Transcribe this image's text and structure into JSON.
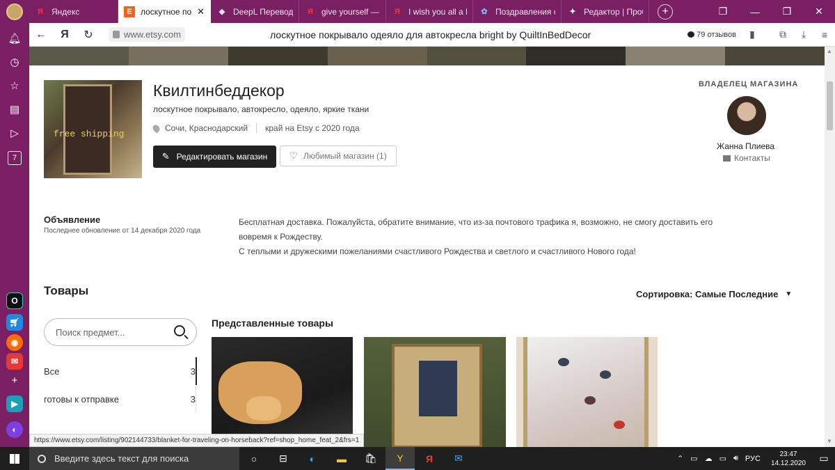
{
  "browser": {
    "tabs": [
      {
        "title": "Яндекс",
        "favicon": "Я",
        "fav_color": "#ff3333",
        "active": false
      },
      {
        "title": "лоскутное пок",
        "favicon": "E",
        "fav_color": "#f1641e",
        "active": true
      },
      {
        "title": "DeepL Переводч",
        "favicon": "◆",
        "fav_color": "#dfe6f0",
        "active": false
      },
      {
        "title": "give yourself — Я",
        "favicon": "Я",
        "fav_color": "#ff3333",
        "active": false
      },
      {
        "title": "I wish you all a M",
        "favicon": "Я",
        "fav_color": "#ff3333",
        "active": false
      },
      {
        "title": "Поздравления с",
        "favicon": "✿",
        "fav_color": "#8ab4f8",
        "active": false
      },
      {
        "title": "Редактор | Проб",
        "favicon": "✦",
        "fav_color": "#ffffff",
        "active": false
      }
    ],
    "new_tab": "+",
    "url_host": "www.etsy.com",
    "page_title": "лоскутное покрывало одеяло для автокресла bright by QuiltInBedDecor",
    "reviews": "79 отзывов",
    "status_url": "https://www.etsy.com/listing/902144733/blanket-for-traveling-on-horseback?ref=shop_home_feat_2&frs=1"
  },
  "sidebar": {
    "badge_count": "7"
  },
  "shop": {
    "image_stamp": "free shipping",
    "name": "Квилтинбеддекор",
    "tagline": "лоскутное покрывало, автокресло, одеяло, яркие ткани",
    "location": "Сочи, Краснодарский",
    "since": "край на Etsy с 2020 года",
    "edit_button": "Редактировать магазин",
    "favorite_button": "Любимый магазин (1)"
  },
  "owner": {
    "label": "ВЛАДЕЛЕЦ МАГАЗИНА",
    "name": "Жанна Плиева",
    "contacts": "Контакты"
  },
  "announcement": {
    "title": "Объявление",
    "updated": "Последнее обновление от 14 декабря 2020 года",
    "line1": "Бесплатная доставка. Пожалуйста, обратите внимание, что из-за почтового трафика я, возможно, не смогу доставить его",
    "line2": "вовремя к Рождеству.",
    "line3": "С теплыми и дружескими пожеланиями счастливого Рождества и светлого и счастливого Нового года!"
  },
  "items": {
    "title": "Товары",
    "sort": "Сортировка: Самые Последние",
    "search_placeholder": "Поиск предмет...",
    "categories": [
      {
        "label": "Все",
        "count": "3"
      },
      {
        "label": "готовы к отправке",
        "count": "3"
      }
    ],
    "featured_title": "Представленные товары"
  },
  "taskbar": {
    "search_placeholder": "Введите здесь текст для поиска",
    "language": "РУС",
    "time": "23:47",
    "date": "14.12.2020"
  }
}
